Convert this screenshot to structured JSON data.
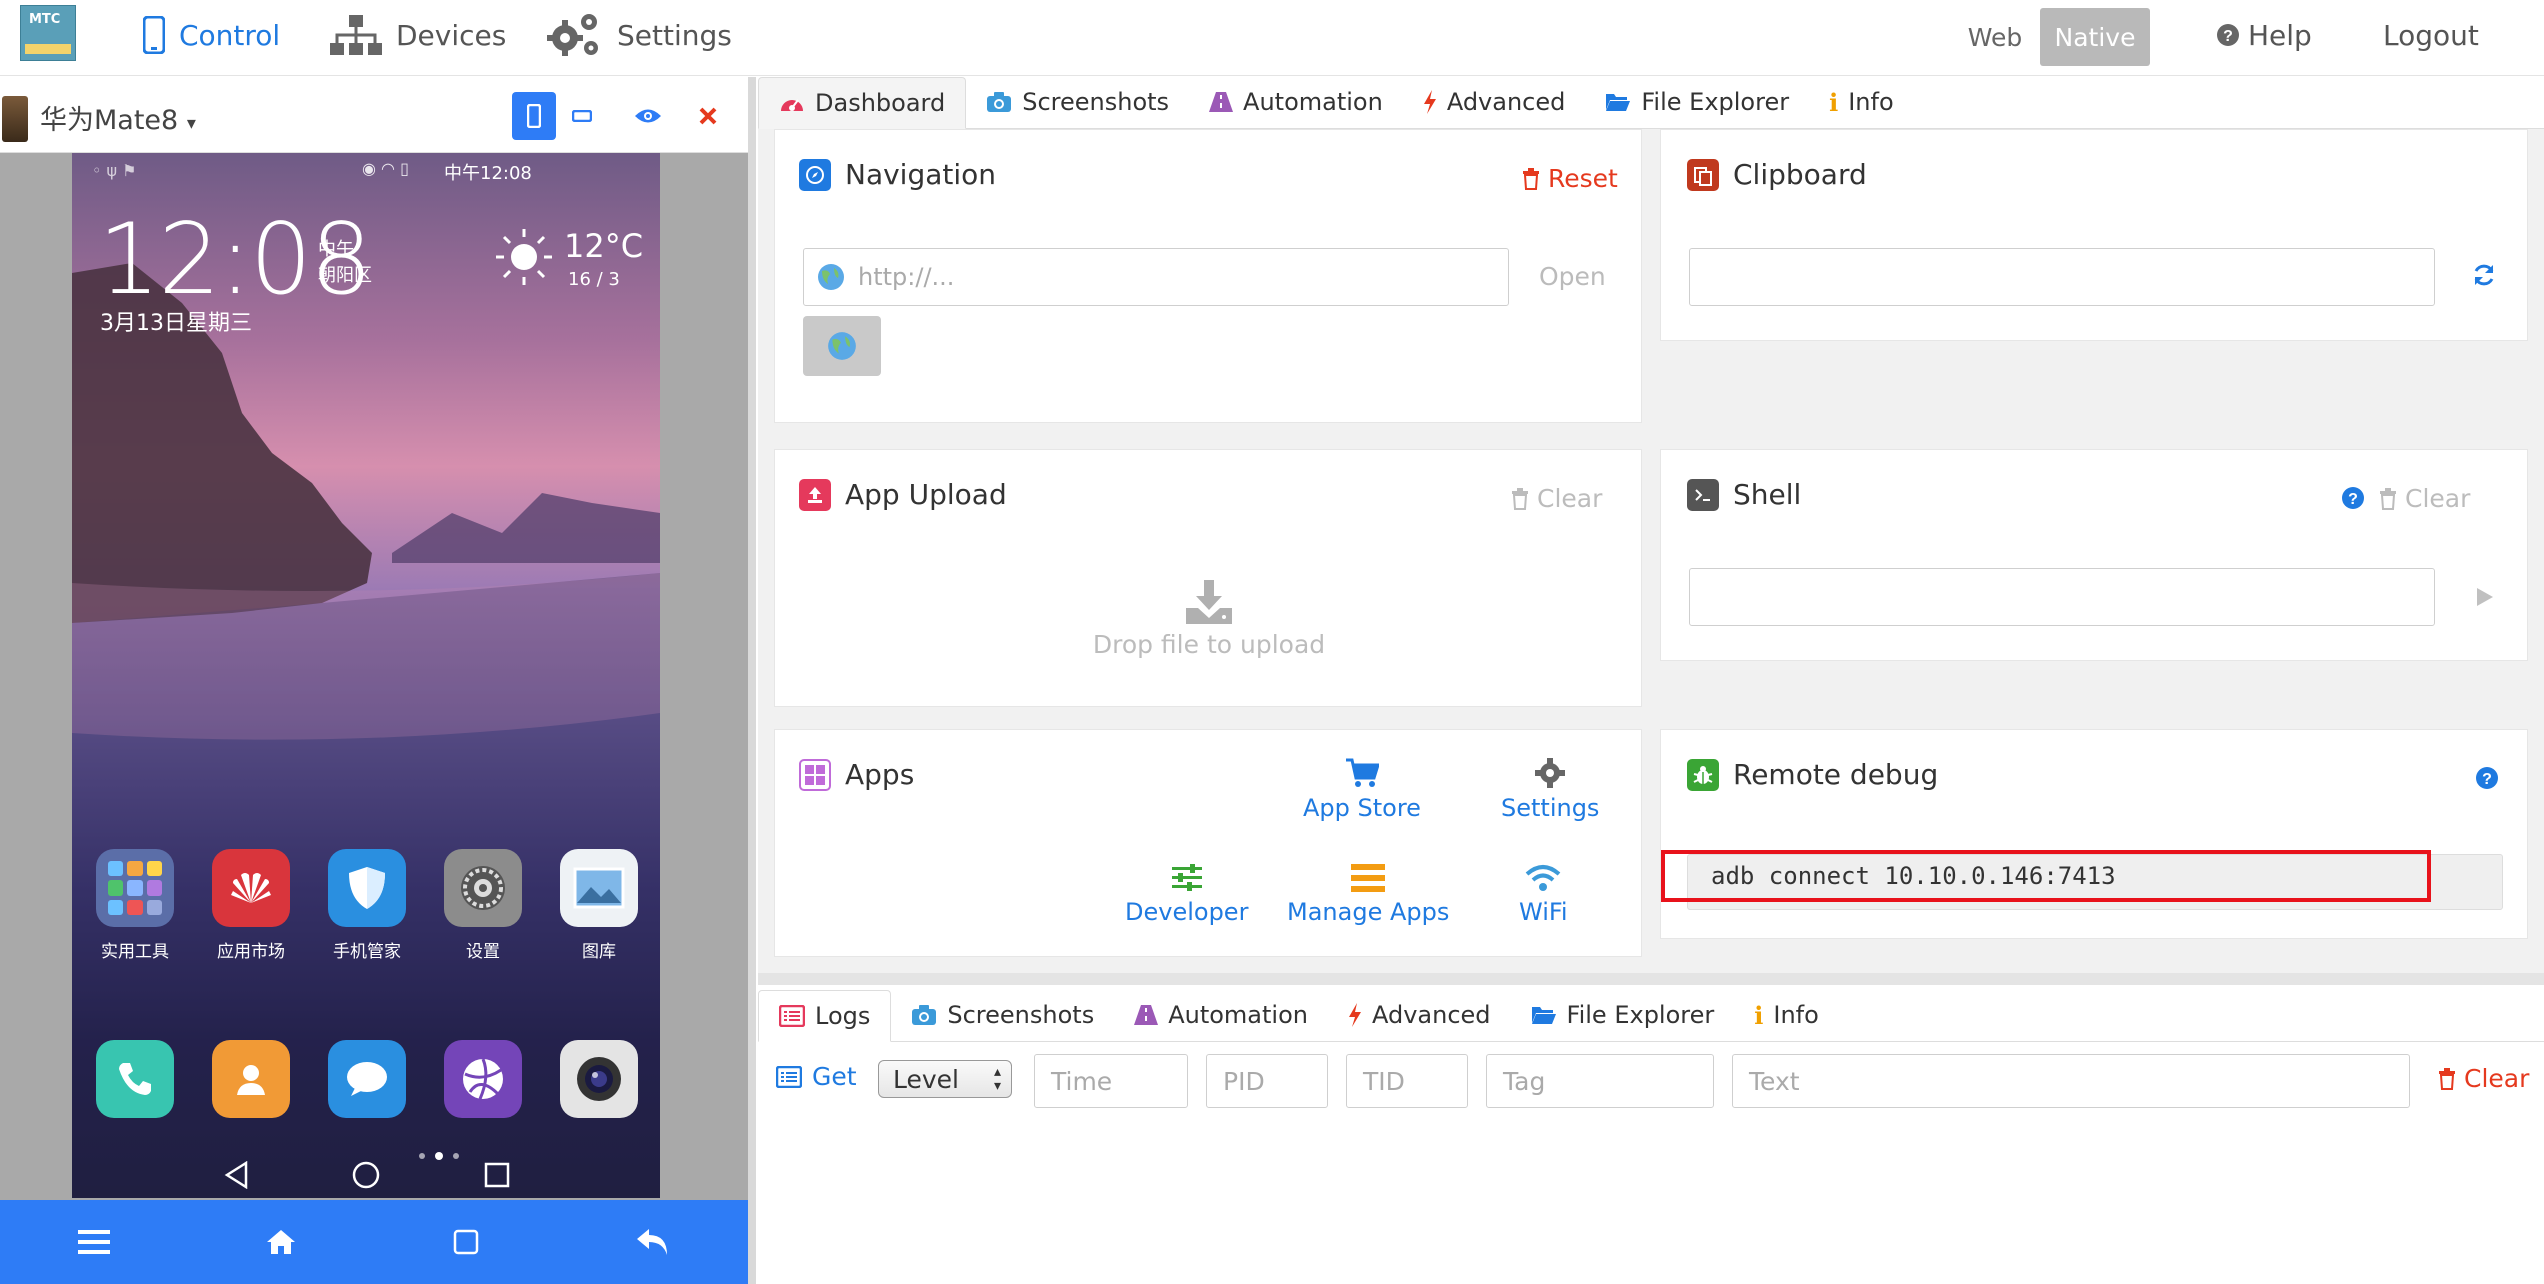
{
  "app": {
    "logo_text": "MTC",
    "nav": [
      {
        "label": "Control"
      },
      {
        "label": "Devices"
      },
      {
        "label": "Settings"
      }
    ],
    "mode_web": "Web",
    "mode_native": "Native",
    "help": "Help",
    "logout": "Logout"
  },
  "device": {
    "name": "华为Mate8",
    "status_time": "中午12:08",
    "clock": "12:08",
    "clock_period": "中午",
    "location": "朝阳区",
    "temp": "12°C",
    "temp_range": "16 / 3",
    "date": "3月13日星期三",
    "apps": [
      "实用工具",
      "应用市场",
      "手机管家",
      "设置",
      "图库"
    ]
  },
  "tabs": [
    "Dashboard",
    "Screenshots",
    "Automation",
    "Advanced",
    "File Explorer",
    "Info"
  ],
  "navigation": {
    "title": "Navigation",
    "reset": "Reset",
    "url_placeholder": "http://...",
    "open": "Open"
  },
  "clipboard": {
    "title": "Clipboard"
  },
  "upload": {
    "title": "App Upload",
    "clear": "Clear",
    "drop": "Drop file to upload"
  },
  "shell": {
    "title": "Shell",
    "clear": "Clear"
  },
  "apps": {
    "title": "Apps",
    "items": [
      "App Store",
      "Settings",
      "Developer",
      "Manage Apps",
      "WiFi"
    ]
  },
  "remote": {
    "title": "Remote debug",
    "command": "adb connect 10.10.0.146:7413"
  },
  "logtabs": [
    "Logs",
    "Screenshots",
    "Automation",
    "Advanced",
    "File Explorer",
    "Info"
  ],
  "logs": {
    "get": "Get",
    "level": "Level",
    "time_ph": "Time",
    "pid_ph": "PID",
    "tid_ph": "TID",
    "tag_ph": "Tag",
    "text_ph": "Text",
    "clear": "Clear"
  },
  "colors": {
    "accent": "#1f7ae0",
    "danger": "#e5391e",
    "bottom_bar": "#2e7cf6",
    "highlight": "#e8121b"
  }
}
